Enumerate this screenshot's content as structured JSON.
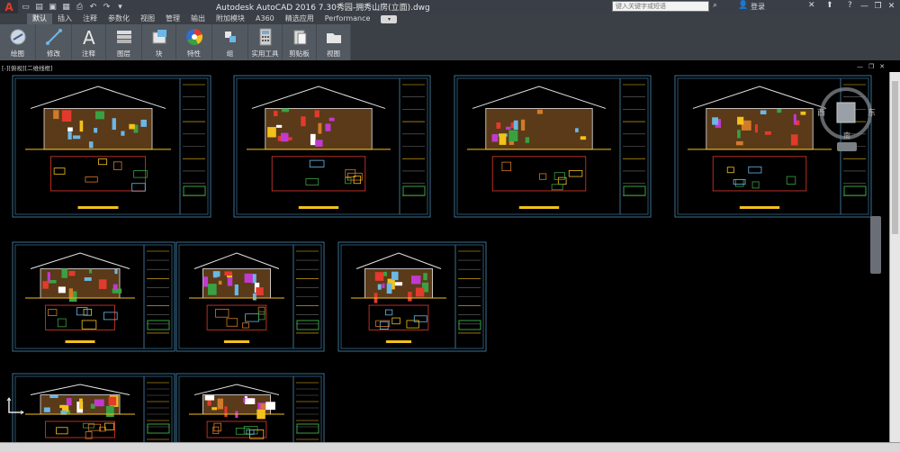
{
  "titlebar": {
    "app_logo": "A",
    "title": "Autodesk AutoCAD 2016    7.30秀园-拥秀山房(立面).dwg",
    "search_placeholder": "键入关键字或短语",
    "login_label": "登录",
    "quick_access": [
      "new-icon",
      "open-icon",
      "save-icon",
      "saveas-icon",
      "print-icon",
      "undo-icon",
      "redo-icon",
      "dropdown-icon"
    ],
    "window_controls": [
      "minimize-icon",
      "restore-icon",
      "close-icon"
    ]
  },
  "ribbon_tabs": {
    "items": [
      "默认",
      "插入",
      "注释",
      "参数化",
      "视图",
      "管理",
      "输出",
      "附加模块",
      "A360",
      "精选应用",
      "Performance"
    ],
    "active": "默认"
  },
  "ribbon": {
    "buttons": [
      {
        "label": "绘图",
        "icon": "draw-icon"
      },
      {
        "label": "修改",
        "icon": "modify-icon"
      },
      {
        "label": "注释",
        "icon": "annotation-icon"
      },
      {
        "label": "图层",
        "icon": "layers-icon"
      },
      {
        "label": "块",
        "icon": "block-icon"
      },
      {
        "label": "特性",
        "icon": "properties-icon"
      },
      {
        "label": "组",
        "icon": "group-icon"
      },
      {
        "label": "实用工具",
        "icon": "utilities-icon"
      },
      {
        "label": "剪贴板",
        "icon": "clipboard-icon"
      },
      {
        "label": "视图",
        "icon": "view-icon"
      }
    ]
  },
  "viewport": {
    "label": "[-][俯视][二维线框]",
    "viewcube": {
      "west": "西",
      "east": "东",
      "south": "南"
    }
  },
  "colors": {
    "titlebar": "#3a3f47",
    "ribbon": "#535961",
    "canvas": "#000000",
    "frame": "#3b6f8f",
    "accent_red": "#e23a2c"
  }
}
